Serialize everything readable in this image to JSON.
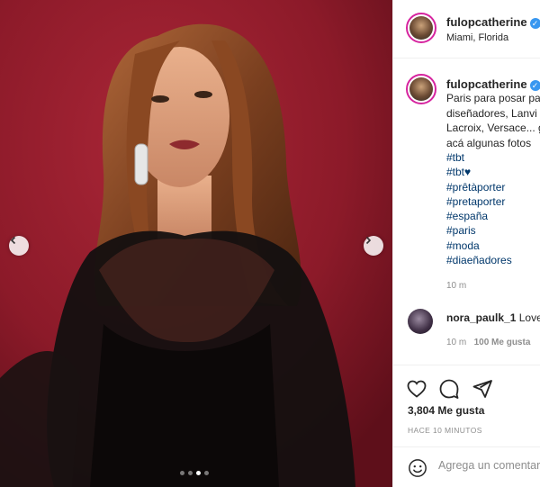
{
  "post": {
    "username": "fulopcatherine",
    "location": "Miami, Florida",
    "caption_lines": [
      "Paris para posar pa",
      "diseñadores, Lanvi",
      "Lacroix, Versace... g",
      "acá algunas fotos"
    ],
    "hashtags": [
      "#tbt",
      "#tbt♥",
      "#prêtàporter",
      "#pretaporter",
      "#españa",
      "#paris",
      "#moda",
      "#diaeñadores"
    ],
    "caption_time": "10 m",
    "likes_count": "3,804 Me gusta",
    "posted_ago": "HACE 10 MINUTOS",
    "carousel_dots": 4,
    "carousel_active_index": 2
  },
  "comment": {
    "username": "nora_paulk_1",
    "text": "Love",
    "time": "10 m",
    "likes": "100 Me gusta"
  },
  "add_comment": {
    "placeholder": "Agrega un comentario..."
  },
  "icons": {
    "verified": "verified-badge-icon",
    "like": "heart-icon",
    "comment": "comment-bubble-icon",
    "share": "paper-plane-icon",
    "emoji": "smiley-icon",
    "prev": "chevron-left-icon",
    "next": "chevron-right-icon"
  },
  "colors": {
    "background_red": "#8e1b2a",
    "link_blue": "#00376b",
    "verified_blue": "#3897f0"
  }
}
